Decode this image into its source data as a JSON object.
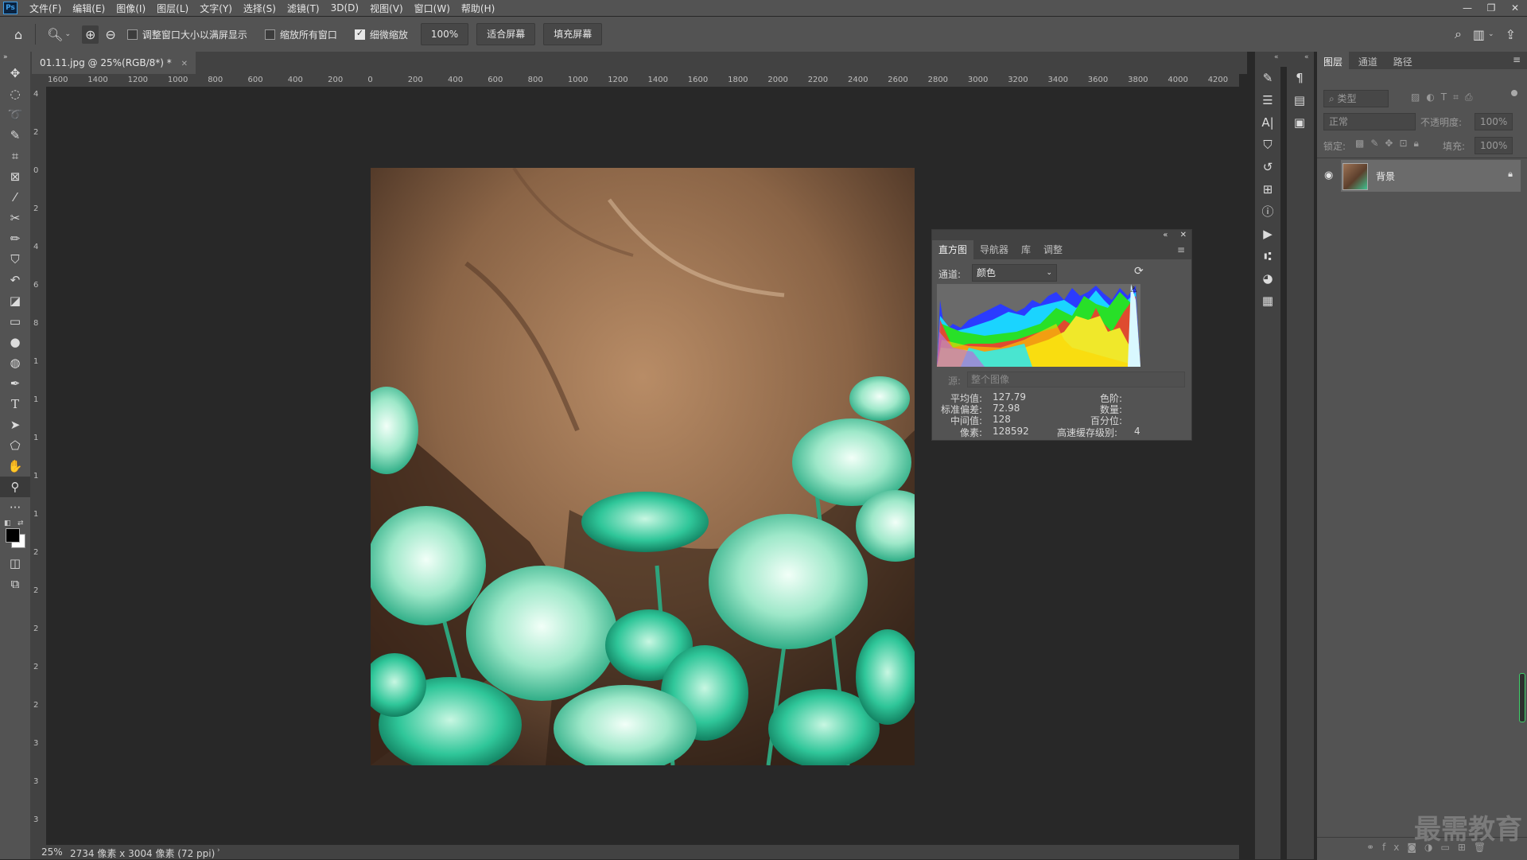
{
  "menubar": {
    "logo": "Ps",
    "items": [
      "文件(F)",
      "编辑(E)",
      "图像(I)",
      "图层(L)",
      "文字(Y)",
      "选择(S)",
      "滤镜(T)",
      "3D(D)",
      "视图(V)",
      "窗口(W)",
      "帮助(H)"
    ]
  },
  "options": {
    "resize_windows": "调整窗口大小以满屏显示",
    "zoom_all": "缩放所有窗口",
    "scrubby_zoom": "细微缩放",
    "zoom_100": "100%",
    "fit_screen": "适合屏幕",
    "fill_screen": "填充屏幕"
  },
  "document": {
    "tab_title": "01.11.jpg @ 25%(RGB/8*) *",
    "zoom": "25%",
    "info": "2734 像素 x 3004 像素 (72 ppi)"
  },
  "ruler": {
    "h_labels": [
      "1600",
      "1400",
      "1200",
      "1000",
      "800",
      "600",
      "400",
      "200",
      "0",
      "200",
      "400",
      "600",
      "800",
      "1000",
      "1200",
      "1400",
      "1600",
      "1800",
      "2000",
      "2200",
      "2400",
      "2600",
      "2800",
      "3000",
      "3200",
      "3400",
      "3600",
      "3800",
      "4000",
      "4200"
    ],
    "v_labels": [
      "4",
      "2",
      "0",
      "2",
      "4",
      "6",
      "8",
      "1",
      "1",
      "1",
      "1",
      "1",
      "2",
      "2",
      "2",
      "2",
      "2",
      "3",
      "3",
      "3"
    ]
  },
  "histogram": {
    "tabs": [
      "直方图",
      "导航器",
      "库",
      "调整"
    ],
    "channel_label": "通道:",
    "channel_value": "颜色",
    "source_label": "源:",
    "source_value": "整个图像",
    "stats": {
      "mean_label": "平均值:",
      "mean": "127.79",
      "std_label": "标准偏差:",
      "std": "72.98",
      "median_label": "中间值:",
      "median": "128",
      "pixels_label": "像素:",
      "pixels": "128592",
      "level_label": "色阶:",
      "count_label": "数量:",
      "percentile_label": "百分位:",
      "cache_label": "高速缓存级别:",
      "cache": "4"
    }
  },
  "layers_panel": {
    "tabs": [
      "图层",
      "通道",
      "路径"
    ],
    "filter_placeholder": "类型",
    "blend_mode": "正常",
    "opacity_label": "不透明度:",
    "opacity": "100%",
    "lock_label": "锁定:",
    "fill_label": "填充:",
    "fill": "100%",
    "layer_name": "背景"
  },
  "watermark": "最需教育"
}
